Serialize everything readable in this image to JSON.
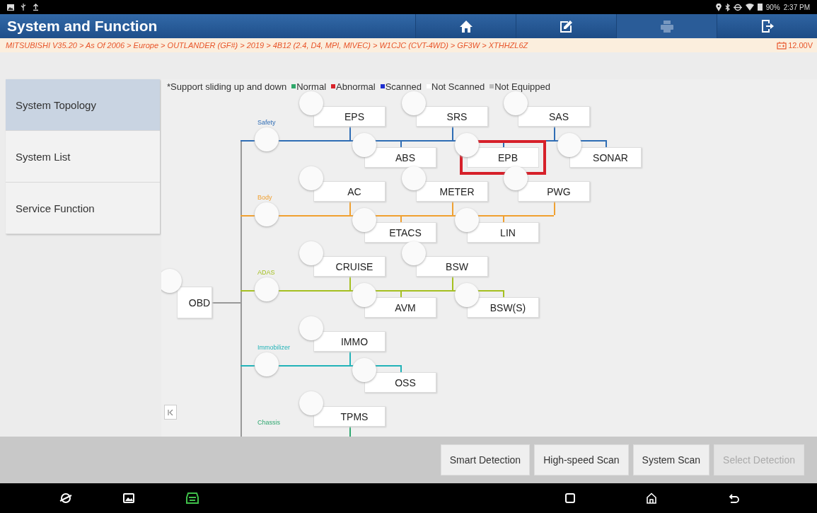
{
  "status_bar": {
    "battery": "90%",
    "time": "2:37 PM"
  },
  "header": {
    "title": "System and Function",
    "buttons": [
      {
        "kind": "home",
        "disabled": false
      },
      {
        "kind": "edit",
        "disabled": false
      },
      {
        "kind": "print",
        "disabled": true
      },
      {
        "kind": "exit",
        "disabled": false
      }
    ]
  },
  "breadcrumb": {
    "path": "MITSUBISHI V35.20 > As Of 2006 > Europe > OUTLANDER (GF#) > 2019 > 4B12 (2.4, D4, MPI, MIVEC) > W1CJC (CVT-4WD) > GF3W > XTHHZL6Z",
    "voltage": "12.00V"
  },
  "sidebar": {
    "items": [
      {
        "label": "System Topology",
        "selected": true
      },
      {
        "label": "System List",
        "selected": false
      },
      {
        "label": "Service Function",
        "selected": false
      }
    ]
  },
  "legend": {
    "note": "*Support sliding up and down",
    "items": [
      {
        "label": "Normal",
        "color": "#2fa86a"
      },
      {
        "label": "Abnormal",
        "color": "#d8232a"
      },
      {
        "label": "Scanned",
        "color": "#1f2fd0"
      },
      {
        "label": "Not Scanned",
        "color": "#ffffff"
      },
      {
        "label": "Not Equipped",
        "color": "#bdbdbd"
      }
    ]
  },
  "topology": {
    "root": "OBD",
    "groups": [
      {
        "name": "Safety",
        "color": "#2f6db5",
        "upper": [
          {
            "label": "EPS",
            "highlighted": false
          },
          {
            "label": "SRS",
            "highlighted": false
          },
          {
            "label": "SAS",
            "highlighted": false
          }
        ],
        "lower": [
          {
            "label": "ABS",
            "highlighted": false
          },
          {
            "label": "EPB",
            "highlighted": true
          },
          {
            "label": "SONAR",
            "highlighted": false
          }
        ]
      },
      {
        "name": "Body",
        "color": "#f0a030",
        "upper": [
          {
            "label": "AC",
            "highlighted": false
          },
          {
            "label": "METER",
            "highlighted": false
          },
          {
            "label": "PWG",
            "highlighted": false
          }
        ],
        "lower": [
          {
            "label": "ETACS",
            "highlighted": false
          },
          {
            "label": "LIN",
            "highlighted": false
          }
        ]
      },
      {
        "name": "ADAS",
        "color": "#a5c020",
        "upper": [
          {
            "label": "CRUISE",
            "highlighted": false
          },
          {
            "label": "BSW",
            "highlighted": false
          }
        ],
        "lower": [
          {
            "label": "AVM",
            "highlighted": false
          },
          {
            "label": "BSW(S)",
            "highlighted": false
          }
        ]
      },
      {
        "name": "Immobilizer",
        "color": "#22b3b8",
        "upper": [
          {
            "label": "IMMO",
            "highlighted": false
          }
        ],
        "lower": [
          {
            "label": "OSS",
            "highlighted": false
          }
        ]
      },
      {
        "name": "Chassis",
        "color": "#2fa870",
        "upper": [
          {
            "label": "TPMS",
            "highlighted": false
          }
        ]
      }
    ]
  },
  "actions": [
    {
      "label": "Smart Detection",
      "disabled": false
    },
    {
      "label": "High-speed Scan",
      "disabled": false
    },
    {
      "label": "System Scan",
      "disabled": false
    },
    {
      "label": "Select Detection",
      "disabled": true
    }
  ]
}
